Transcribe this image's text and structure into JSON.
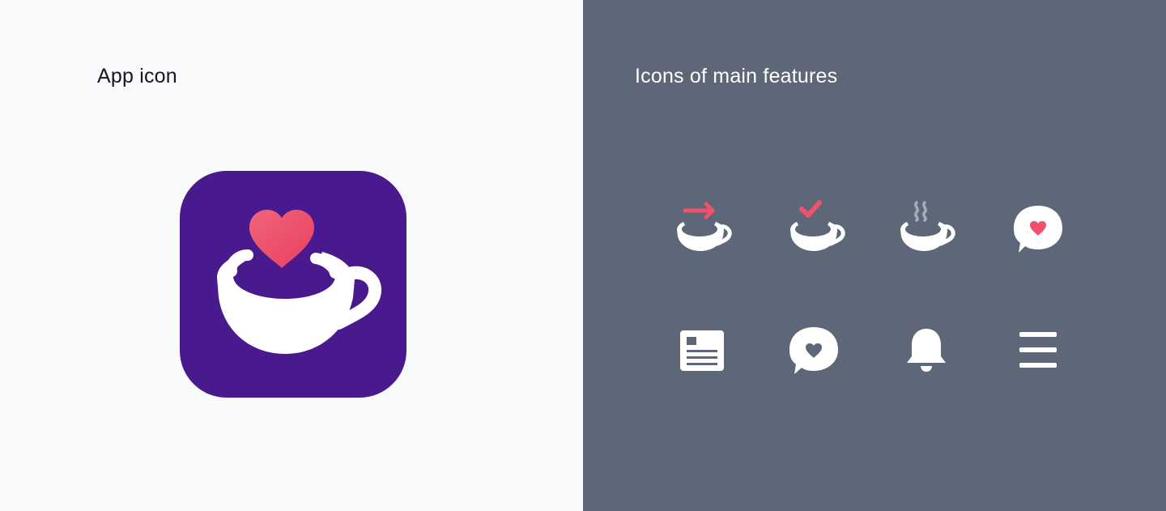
{
  "left": {
    "title": "App icon",
    "background": "#f9fafc",
    "app_icon": {
      "icon": "coffee-cup-heart-icon",
      "background_color": "#481a8e",
      "heart_color": "#ee4e6a",
      "cup_color": "#ffffff"
    }
  },
  "right": {
    "title": "Icons of main features",
    "background": "#5e6778",
    "icons": [
      {
        "name": "coffee-arrow-icon"
      },
      {
        "name": "coffee-check-icon"
      },
      {
        "name": "coffee-steam-icon"
      },
      {
        "name": "speech-bubble-heart-icon"
      },
      {
        "name": "news-icon"
      },
      {
        "name": "chat-heart-icon"
      },
      {
        "name": "bell-icon"
      },
      {
        "name": "menu-icon"
      }
    ],
    "accent_color": "#f0516c",
    "steam_color": "#a7adb8",
    "icon_color": "#ffffff"
  }
}
